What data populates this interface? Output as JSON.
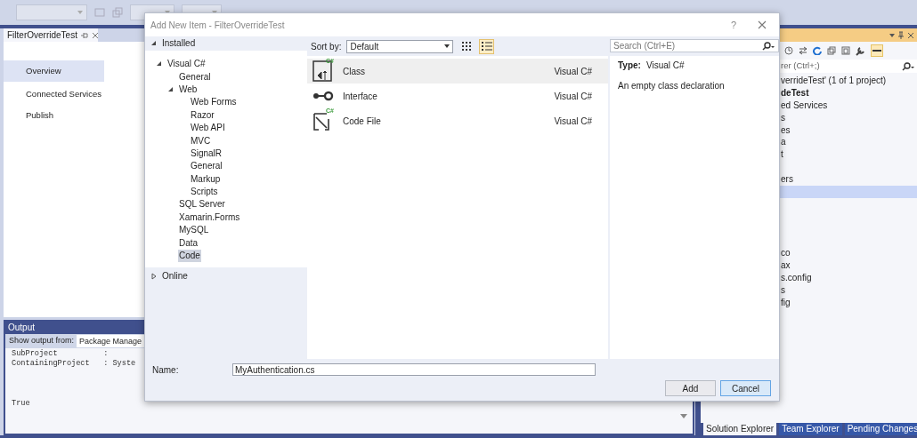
{
  "document_tab": {
    "title": "FilterOverrideTest"
  },
  "project_nav": [
    {
      "label": "Overview",
      "selected": true
    },
    {
      "label": "Connected Services",
      "selected": false
    },
    {
      "label": "Publish",
      "selected": false
    }
  ],
  "output": {
    "title": "Output",
    "source_label": "Show output from:",
    "source": "Package Manage",
    "lines": [
      "SubProject          :",
      "ContainingProject   : Syste"
    ],
    "result": "True"
  },
  "solution_explorer": {
    "search_placeholder": "rer (Ctrl+;)",
    "rows": [
      {
        "label": "verrideTest' (1 of 1 project)",
        "bold": false,
        "selected": false
      },
      {
        "label": "deTest",
        "bold": true,
        "selected": false
      },
      {
        "label": "ed Services",
        "bold": false,
        "selected": false
      },
      {
        "label": "s",
        "bold": false,
        "selected": false
      },
      {
        "label": "es",
        "bold": false,
        "selected": false
      },
      {
        "label": "a",
        "bold": false,
        "selected": false
      },
      {
        "label": "t",
        "bold": false,
        "selected": false
      },
      {
        "selected": false
      },
      {
        "label": "ers",
        "bold": false,
        "selected": false
      },
      {
        "selected": true
      },
      {
        "selected": false
      },
      {
        "selected": false
      },
      {
        "selected": false
      },
      {
        "selected": false
      },
      {
        "label": "co",
        "bold": false,
        "selected": false
      },
      {
        "label": "ax",
        "bold": false,
        "selected": false
      },
      {
        "label": "s.config",
        "bold": false,
        "selected": false
      },
      {
        "label": "s",
        "bold": false,
        "selected": false
      },
      {
        "label": "fig",
        "bold": false,
        "selected": false
      }
    ],
    "tabs": [
      {
        "label": "Solution Explorer",
        "selected": true
      },
      {
        "label": "Team Explorer",
        "selected": false
      },
      {
        "label": "Pending Changes",
        "selected": false
      }
    ]
  },
  "dialog": {
    "title": "Add New Item - FilterOverrideTest",
    "help": "?",
    "categories": [
      {
        "label": "Installed",
        "expanded": true,
        "children": [
          {
            "label": "Visual C#",
            "expanded": true,
            "selected": false,
            "children": [
              {
                "label": "General",
                "selected": false
              },
              {
                "label": "Web",
                "expanded": true,
                "selected": false,
                "children": [
                  {
                    "label": "Web Forms",
                    "selected": false
                  },
                  {
                    "label": "Razor",
                    "selected": false
                  },
                  {
                    "label": "Web API",
                    "selected": false
                  },
                  {
                    "label": "MVC",
                    "selected": false
                  },
                  {
                    "label": "SignalR",
                    "selected": false
                  },
                  {
                    "label": "General",
                    "selected": false
                  },
                  {
                    "label": "Markup",
                    "selected": false
                  },
                  {
                    "label": "Scripts",
                    "selected": false
                  }
                ]
              },
              {
                "label": "SQL Server",
                "selected": false
              },
              {
                "label": "Xamarin.Forms",
                "selected": false
              },
              {
                "label": "MySQL",
                "selected": false
              },
              {
                "label": "Data",
                "selected": false
              },
              {
                "label": "Code",
                "selected": true
              }
            ]
          }
        ]
      },
      {
        "label": "Online",
        "expanded": false
      }
    ],
    "sort_label": "Sort by:",
    "sort_value": "Default",
    "views": [
      {
        "kind": "grid",
        "selected": false
      },
      {
        "kind": "list",
        "selected": true
      }
    ],
    "search_placeholder": "Search (Ctrl+E)",
    "templates": [
      {
        "name": "Class",
        "language": "Visual C#",
        "kind": "class",
        "badge": "C#",
        "selected": true
      },
      {
        "name": "Interface",
        "language": "Visual C#",
        "kind": "interface",
        "selected": false
      },
      {
        "name": "Code File",
        "language": "Visual C#",
        "kind": "codefile",
        "badge": "C#",
        "selected": false
      }
    ],
    "details": {
      "type_label": "Type:",
      "type_value": "Visual C#",
      "description": "An empty class declaration"
    },
    "name_label": "Name:",
    "name_value": "MyAuthentication.cs",
    "buttons": [
      {
        "label": "Add",
        "default": false
      },
      {
        "label": "Cancel",
        "default": true
      }
    ]
  }
}
